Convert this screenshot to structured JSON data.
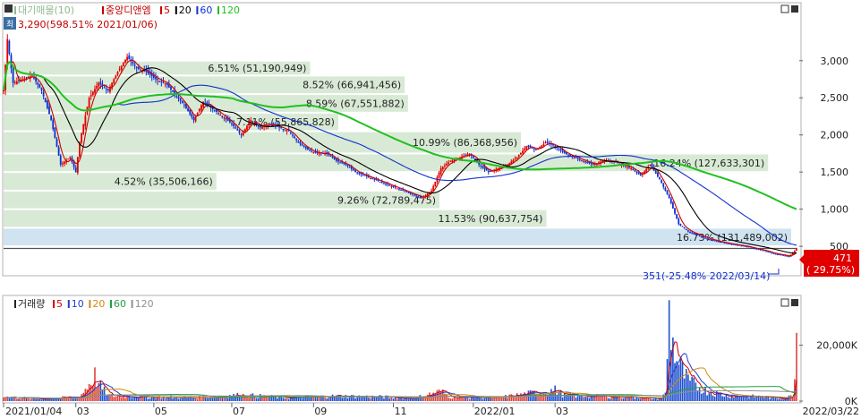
{
  "legend_price": [
    {
      "text": "대기매물(10)",
      "color": "#8fb98f"
    },
    {
      "text": "중앙디앤엠",
      "color": "#c00000"
    },
    {
      "text": "5",
      "color": "#d00000"
    },
    {
      "text": "20",
      "color": "#000000"
    },
    {
      "text": "60",
      "color": "#1030d0"
    },
    {
      "text": "120",
      "color": "#20c020"
    }
  ],
  "legend_volume": [
    {
      "text": "거래량",
      "color": "#222222"
    },
    {
      "text": "5",
      "color": "#d00000"
    },
    {
      "text": "10",
      "color": "#2040d0"
    },
    {
      "text": "20",
      "color": "#d08a10"
    },
    {
      "text": "60",
      "color": "#20a040"
    },
    {
      "text": "120",
      "color": "#909090"
    }
  ],
  "high_annotation": "3,290(598.51% 2021/01/06)",
  "low_annotation": "351(-25.48% 2022/03/14)",
  "current_price": {
    "value": "471",
    "change": "( 29.75%)"
  },
  "chart_data": [
    {
      "type": "candlestick",
      "y_ticks": [
        "3,000",
        "2,500",
        "2,000",
        "1,500",
        "1,000",
        "500"
      ],
      "ylim": [
        200,
        3600
      ],
      "x_ticks": [
        "2021/01/04",
        "03",
        "05",
        "07",
        "09",
        "11",
        "2022/01",
        "03",
        "2022/03/22"
      ],
      "volume_profile": [
        {
          "label": "6.51% (51,190,949)",
          "price_range": [
            2800,
            3000
          ]
        },
        {
          "label": "8.52% (66,941,456)",
          "price_range": [
            2550,
            2800
          ]
        },
        {
          "label": "8.59% (67,551,882)",
          "price_range": [
            2300,
            2550
          ]
        },
        {
          "label": "7.11% (55,865,828)",
          "price_range": [
            2050,
            2300
          ]
        },
        {
          "label": "10.99% (86,368,956)",
          "price_range": [
            1750,
            2050
          ]
        },
        {
          "label": "16.24% (127,633,301)",
          "price_range": [
            1500,
            1750
          ]
        },
        {
          "label": "4.52% (35,506,166)",
          "price_range": [
            1250,
            1500
          ]
        },
        {
          "label": "9.26% (72,789,475)",
          "price_range": [
            1000,
            1250
          ]
        },
        {
          "label": "11.53% (90,637,754)",
          "price_range": [
            750,
            1000
          ]
        },
        {
          "label": "16.73% (131,489,002)",
          "price_range": [
            500,
            750
          ]
        }
      ],
      "price_anchors": [
        [
          0,
          2600
        ],
        [
          2,
          3290
        ],
        [
          5,
          2700
        ],
        [
          10,
          2750
        ],
        [
          15,
          2800
        ],
        [
          20,
          2600
        ],
        [
          25,
          2200
        ],
        [
          30,
          1600
        ],
        [
          35,
          1700
        ],
        [
          38,
          1500
        ],
        [
          40,
          1900
        ],
        [
          45,
          2500
        ],
        [
          50,
          2700
        ],
        [
          55,
          2600
        ],
        [
          60,
          2850
        ],
        [
          65,
          3050
        ],
        [
          70,
          2900
        ],
        [
          75,
          2850
        ],
        [
          80,
          2750
        ],
        [
          85,
          2700
        ],
        [
          90,
          2550
        ],
        [
          95,
          2400
        ],
        [
          100,
          2200
        ],
        [
          105,
          2450
        ],
        [
          110,
          2350
        ],
        [
          115,
          2250
        ],
        [
          120,
          2150
        ],
        [
          125,
          2000
        ],
        [
          130,
          2200
        ],
        [
          135,
          2100
        ],
        [
          140,
          2150
        ],
        [
          145,
          2100
        ],
        [
          150,
          2050
        ],
        [
          155,
          1900
        ],
        [
          160,
          1800
        ],
        [
          165,
          1750
        ],
        [
          170,
          1750
        ],
        [
          175,
          1650
        ],
        [
          180,
          1600
        ],
        [
          185,
          1500
        ],
        [
          190,
          1450
        ],
        [
          195,
          1400
        ],
        [
          200,
          1350
        ],
        [
          205,
          1300
        ],
        [
          210,
          1250
        ],
        [
          215,
          1200
        ],
        [
          220,
          1150
        ],
        [
          225,
          1250
        ],
        [
          230,
          1550
        ],
        [
          235,
          1650
        ],
        [
          240,
          1700
        ],
        [
          245,
          1750
        ],
        [
          250,
          1600
        ],
        [
          255,
          1500
        ],
        [
          260,
          1550
        ],
        [
          265,
          1600
        ],
        [
          270,
          1700
        ],
        [
          275,
          1850
        ],
        [
          280,
          1800
        ],
        [
          285,
          1900
        ],
        [
          290,
          1850
        ],
        [
          295,
          1750
        ],
        [
          300,
          1700
        ],
        [
          305,
          1650
        ],
        [
          310,
          1600
        ],
        [
          315,
          1650
        ],
        [
          320,
          1650
        ],
        [
          325,
          1600
        ],
        [
          330,
          1550
        ],
        [
          335,
          1450
        ],
        [
          340,
          1600
        ],
        [
          345,
          1400
        ],
        [
          350,
          1150
        ],
        [
          355,
          800
        ],
        [
          360,
          700
        ],
        [
          365,
          650
        ],
        [
          370,
          600
        ],
        [
          375,
          570
        ],
        [
          380,
          540
        ],
        [
          385,
          520
        ],
        [
          390,
          500
        ],
        [
          395,
          470
        ],
        [
          400,
          440
        ],
        [
          405,
          400
        ],
        [
          410,
          380
        ],
        [
          413,
          360
        ],
        [
          417,
          471
        ]
      ],
      "volume_unit_ticks": [
        "20,000K",
        "0K"
      ],
      "volume_anchors": [
        [
          0,
          1500
        ],
        [
          10,
          1200
        ],
        [
          20,
          800
        ],
        [
          40,
          1500
        ],
        [
          48,
          9000
        ],
        [
          50,
          6000
        ],
        [
          55,
          2000
        ],
        [
          75,
          1500
        ],
        [
          100,
          1200
        ],
        [
          125,
          2200
        ],
        [
          150,
          1200
        ],
        [
          175,
          1800
        ],
        [
          200,
          1500
        ],
        [
          215,
          900
        ],
        [
          230,
          3500
        ],
        [
          235,
          1500
        ],
        [
          260,
          1200
        ],
        [
          290,
          4000
        ],
        [
          295,
          2000
        ],
        [
          330,
          1500
        ],
        [
          345,
          800
        ],
        [
          348,
          2500
        ],
        [
          350,
          31000
        ],
        [
          352,
          20000
        ],
        [
          355,
          13000
        ],
        [
          360,
          7000
        ],
        [
          370,
          3500
        ],
        [
          380,
          2000
        ],
        [
          400,
          1500
        ],
        [
          410,
          800
        ],
        [
          415,
          2000
        ],
        [
          417,
          25000
        ]
      ],
      "volume_ylim": [
        0,
        33000
      ],
      "ma_colors": {
        "ma5": "#d00000",
        "ma20": "#000000",
        "ma60": "#1030d0",
        "ma120": "#20c020"
      }
    }
  ]
}
